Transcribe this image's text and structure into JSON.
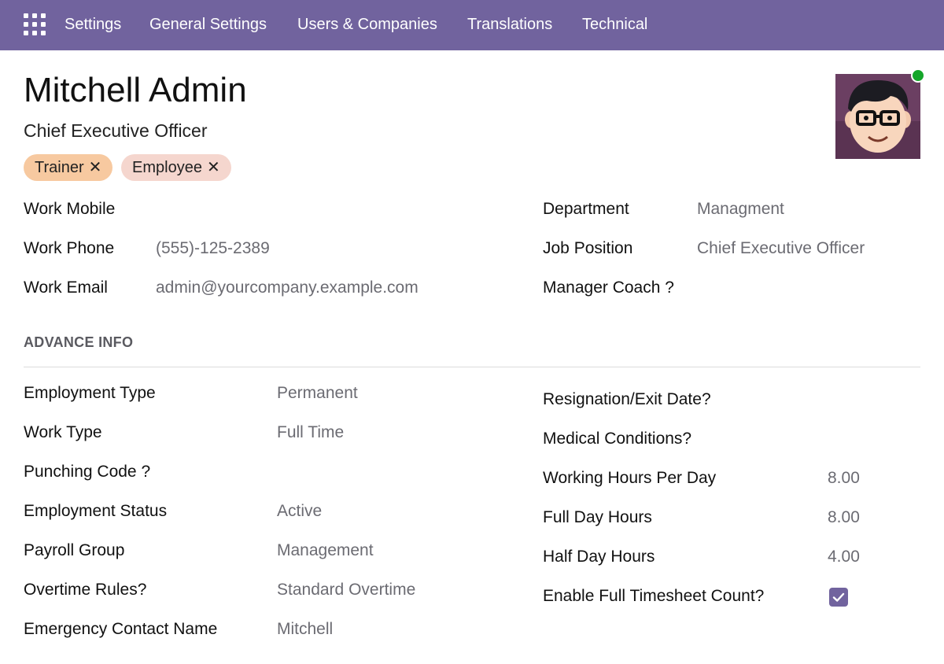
{
  "nav": {
    "items": [
      "Settings",
      "General Settings",
      "Users & Companies",
      "Translations",
      "Technical"
    ]
  },
  "header": {
    "name": "Mitchell Admin",
    "job_title": "Chief Executive Officer",
    "tags": [
      {
        "label": "Trainer",
        "color": "#f7c9a0"
      },
      {
        "label": "Employee",
        "color": "#f5d6ce"
      }
    ],
    "status_color": "#15a62a"
  },
  "contact": {
    "work_mobile": {
      "label": "Work Mobile",
      "value": ""
    },
    "work_phone": {
      "label": "Work Phone",
      "value": "(555)-125-2389"
    },
    "work_email": {
      "label": "Work Email",
      "value": "admin@yourcompany.example.com"
    },
    "department": {
      "label": "Department",
      "value": "Managment"
    },
    "job_position": {
      "label": "Job Position",
      "value": "Chief Executive Officer"
    },
    "manager_coach": {
      "label": "Manager Coach ?",
      "value": ""
    }
  },
  "advance": {
    "section_title": "ADVANCE INFO",
    "left": [
      {
        "label": "Employment Type",
        "value": "Permanent"
      },
      {
        "label": "Work Type",
        "value": "Full Time"
      },
      {
        "label": "Punching Code ?",
        "value": ""
      },
      {
        "label": "Employment Status",
        "value": "Active"
      },
      {
        "label": "Payroll Group",
        "value": "Management"
      },
      {
        "label": "Overtime Rules?",
        "value": "Standard Overtime"
      },
      {
        "label": "Emergency Contact Name",
        "value": "Mitchell"
      }
    ],
    "right": [
      {
        "label": "Resignation/Exit Date?",
        "value": ""
      },
      {
        "label": "Medical Conditions?",
        "value": ""
      },
      {
        "label": "Working Hours Per Day",
        "value": "8.00"
      },
      {
        "label": "Full Day Hours",
        "value": "8.00"
      },
      {
        "label": "Half Day Hours",
        "value": "4.00"
      },
      {
        "label": "Enable Full Timesheet Count?",
        "checked": true
      }
    ]
  },
  "colors": {
    "navbar": "#71639e",
    "checkbox": "#71639e"
  }
}
